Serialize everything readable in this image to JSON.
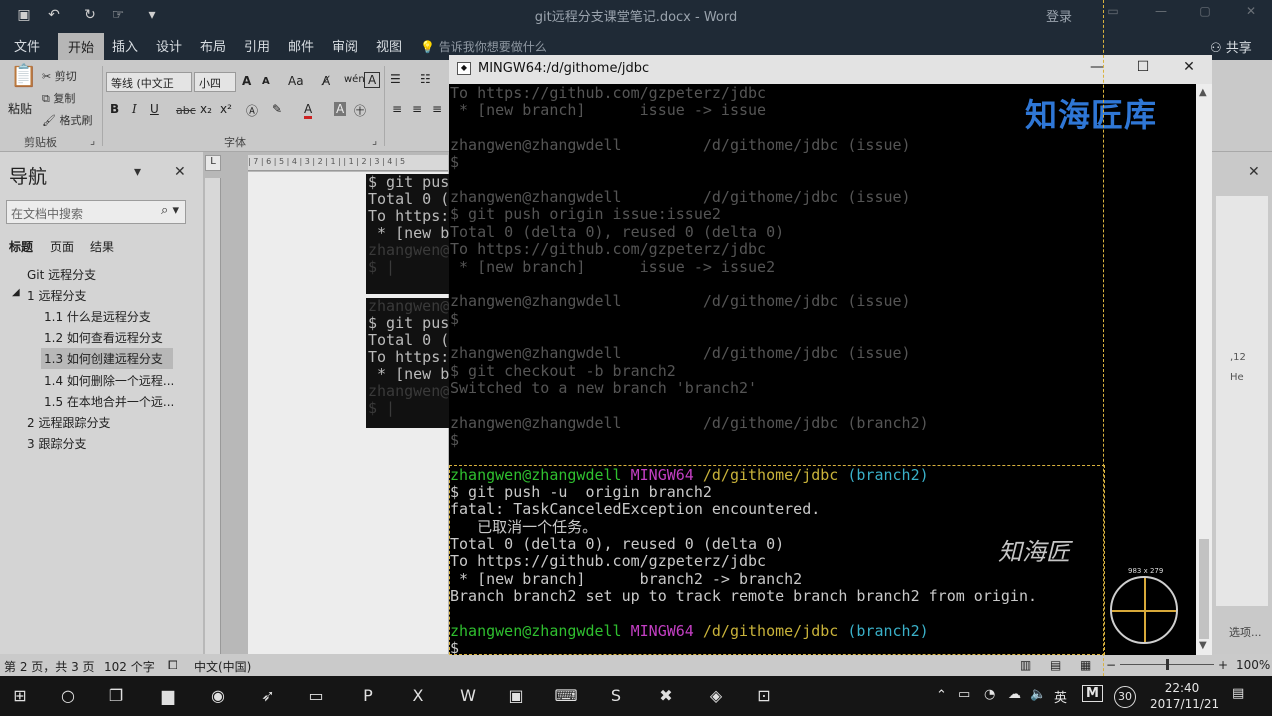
{
  "word": {
    "title": "git远程分支课堂笔记.docx - Word",
    "login": "登录",
    "tabs": [
      "文件",
      "开始",
      "插入",
      "设计",
      "布局",
      "引用",
      "邮件",
      "审阅",
      "视图"
    ],
    "tell_me": "告诉我你想要做什么",
    "share": "共享",
    "ribbon": {
      "paste": "粘贴",
      "cut": "剪切",
      "copy": "复制",
      "format_painter": "格式刷",
      "clipboard_group": "剪贴板",
      "font_name": "等线 (中文正",
      "font_size": "小四",
      "font_group": "字体",
      "aa": "Aa",
      "grow": "A",
      "shrink": "A",
      "bold": "B",
      "italic": "I",
      "underline": "U",
      "strike": "abc",
      "sub": "x₂",
      "sup": "x²",
      "wen": "wén",
      "font_color": "A"
    },
    "nav": {
      "title": "导航",
      "search_placeholder": "在文档中搜索",
      "tabs": [
        "标题",
        "页面",
        "结果"
      ],
      "items": [
        "Git 远程分支",
        "1 远程分支",
        "1.1 什么是远程分支",
        "1.2 如何查看远程分支",
        "1.3 如何创建远程分支",
        "1.4 如何删除一个远程...",
        "1.5 在本地合并一个远...",
        "2 远程跟踪分支",
        "3 跟踪分支"
      ]
    },
    "status": {
      "page": "第 2 页，共 3 页",
      "words": "102 个字",
      "lang": "中文(中国)",
      "zoom": "100%"
    },
    "right_pane_option": "选项...",
    "right_pane_glyphs": [
      ",12",
      "He"
    ],
    "thumb1_lines": [
      "$ git pus",
      "Total 0 (",
      "To https:",
      " * [new b",
      "zhangwen@",
      "$ |"
    ],
    "thumb2_lines": [
      "zhangwen@",
      "$ git pus",
      "Total 0 (",
      "To https:",
      " * [new b",
      "zhangwen@",
      "$ |"
    ]
  },
  "terminal": {
    "title": "MINGW64:/d/githome/jdbc",
    "lines": [
      {
        "text": "To https://github.com/gzpeterz/jdbc",
        "style": "faded"
      },
      {
        "text": " * [new branch]      issue -> issue",
        "style": "faded"
      },
      {
        "text": "",
        "style": "faded"
      },
      {
        "text": "zhangwen@zhangwdell         /d/githome/jdbc (issue)",
        "style": "faded"
      },
      {
        "text": "$",
        "style": "faded"
      },
      {
        "text": "",
        "style": "faded"
      },
      {
        "text": "zhangwen@zhangwdell         /d/githome/jdbc (issue)",
        "style": "faded"
      },
      {
        "text": "$ git push origin issue:issue2",
        "style": "faded"
      },
      {
        "text": "Total 0 (delta 0), reused 0 (delta 0)",
        "style": "faded"
      },
      {
        "text": "To https://github.com/gzpeterz/jdbc",
        "style": "faded"
      },
      {
        "text": " * [new branch]      issue -> issue2",
        "style": "faded"
      },
      {
        "text": "",
        "style": "faded"
      },
      {
        "text": "zhangwen@zhangwdell         /d/githome/jdbc (issue)",
        "style": "faded"
      },
      {
        "text": "$",
        "style": "faded"
      },
      {
        "text": "",
        "style": "faded"
      },
      {
        "text": "zhangwen@zhangwdell         /d/githome/jdbc (issue)",
        "style": "faded"
      },
      {
        "text": "$ git checkout -b branch2",
        "style": "faded"
      },
      {
        "text": "Switched to a new branch 'branch2'",
        "style": "faded"
      },
      {
        "text": "",
        "style": "faded"
      },
      {
        "text": "zhangwen@zhangwdell         /d/githome/jdbc (branch2)",
        "style": "faded"
      },
      {
        "text": "$",
        "style": "faded"
      },
      {
        "text": "",
        "style": "faded"
      },
      {
        "user": "zhangwen@zhangwdell",
        "host": "MINGW64",
        "path": "/d/githome/jdbc",
        "branch": "(branch2)",
        "style": "prompt"
      },
      {
        "text": "$ git push -u  origin branch2",
        "style": "normal"
      },
      {
        "text": "fatal: TaskCanceledException encountered.",
        "style": "normal"
      },
      {
        "text": "   已取消一个任务。",
        "style": "normal"
      },
      {
        "text": "Total 0 (delta 0), reused 0 (delta 0)",
        "style": "normal"
      },
      {
        "text": "To https://github.com/gzpeterz/jdbc",
        "style": "normal"
      },
      {
        "text": " * [new branch]      branch2 -> branch2",
        "style": "normal"
      },
      {
        "text": "Branch branch2 set up to track remote branch branch2 from origin.",
        "style": "normal"
      },
      {
        "text": "",
        "style": "normal"
      },
      {
        "user": "zhangwen@zhangwdell",
        "host": "MINGW64",
        "path": "/d/githome/jdbc",
        "branch": "(branch2)",
        "style": "prompt"
      },
      {
        "text": "$ ",
        "style": "normal"
      }
    ]
  },
  "overlay": {
    "watermark": "知海匠库",
    "brand_script": "知海匠",
    "capture_dims": "983 x 279"
  },
  "taskbar": {
    "ime": "英",
    "ime2": "M",
    "badge": "30",
    "time": "22:40",
    "date": "2017/11/21"
  },
  "colors": {
    "prompt_user": "#2fbf2f",
    "prompt_host": "#c33fc3",
    "prompt_path": "#c8b23a",
    "prompt_branch": "#3ab0c8",
    "watermark": "#2f77d6",
    "dash": "#d9b23e"
  }
}
